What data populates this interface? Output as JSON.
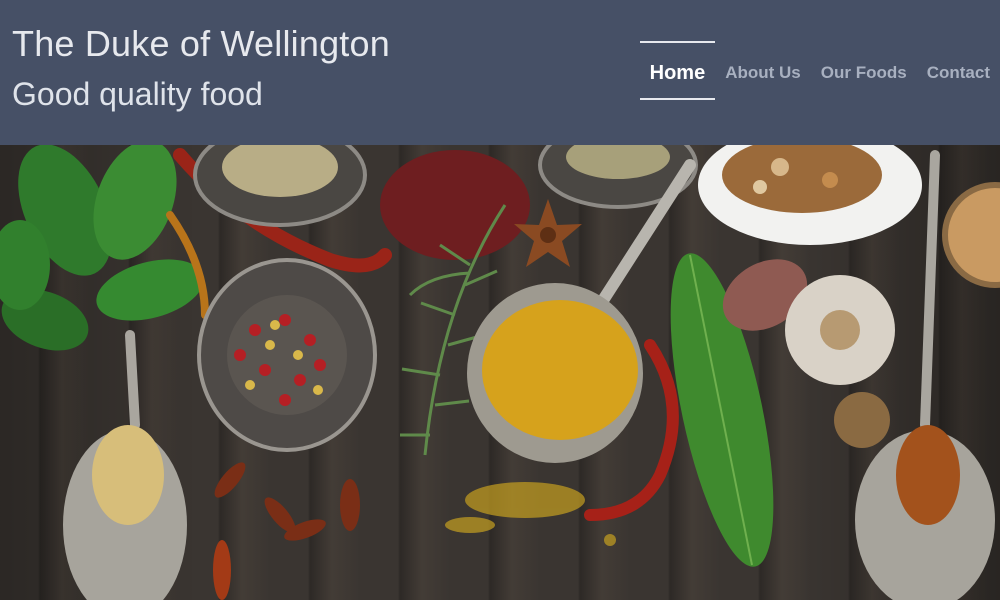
{
  "site": {
    "title": "The Duke of Wellington",
    "tagline": "Good quality food"
  },
  "nav": {
    "items": [
      {
        "label": "Home",
        "active": true
      },
      {
        "label": "About Us",
        "active": false
      },
      {
        "label": "Our Foods",
        "active": false
      },
      {
        "label": "Contact",
        "active": false
      }
    ]
  },
  "colors": {
    "header_bg": "#465066",
    "nav_active": "#ffffff",
    "nav_inactive": "#a8b0c0"
  }
}
